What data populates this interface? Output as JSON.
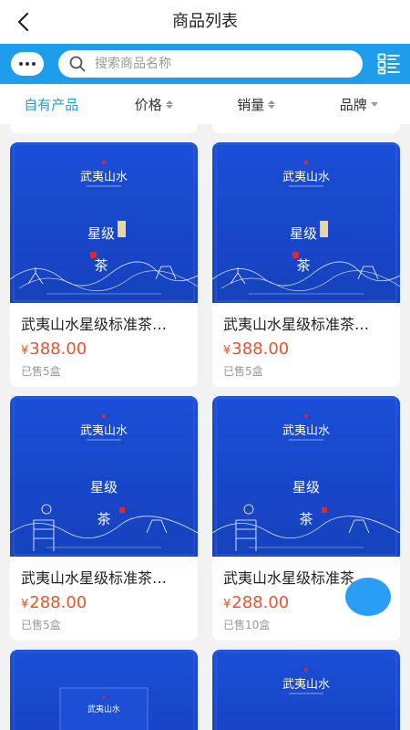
{
  "header": {
    "title": "商品列表"
  },
  "search": {
    "placeholder": "搜索商品名称"
  },
  "filters": [
    {
      "label": "自有产品",
      "active": true
    },
    {
      "label": "价格"
    },
    {
      "label": "销量"
    },
    {
      "label": "品牌"
    }
  ],
  "products": [
    {
      "name": "武夷山水星级标准茶…",
      "price": "388.00",
      "currency": "¥",
      "sold": "已售5盒"
    },
    {
      "name": "武夷山水星级标准茶…",
      "price": "388.00",
      "currency": "¥",
      "sold": "已售5盒"
    },
    {
      "name": "武夷山水星级标准茶…",
      "price": "288.00",
      "currency": "¥",
      "sold": "已售5盒"
    },
    {
      "name": "武夷山水星级标准茶…",
      "price": "288.00",
      "currency": "¥",
      "sold": "已售10盒"
    }
  ],
  "box_art": {
    "brand": "武夷山水",
    "series": "星级",
    "tea": "茶",
    "colors": {
      "box_blue": "#1846c8",
      "seal_red": "#e0282c"
    }
  },
  "colors": {
    "accent": "#1e9dec",
    "price": "#e8532c",
    "float_button": "#2a9df4"
  }
}
